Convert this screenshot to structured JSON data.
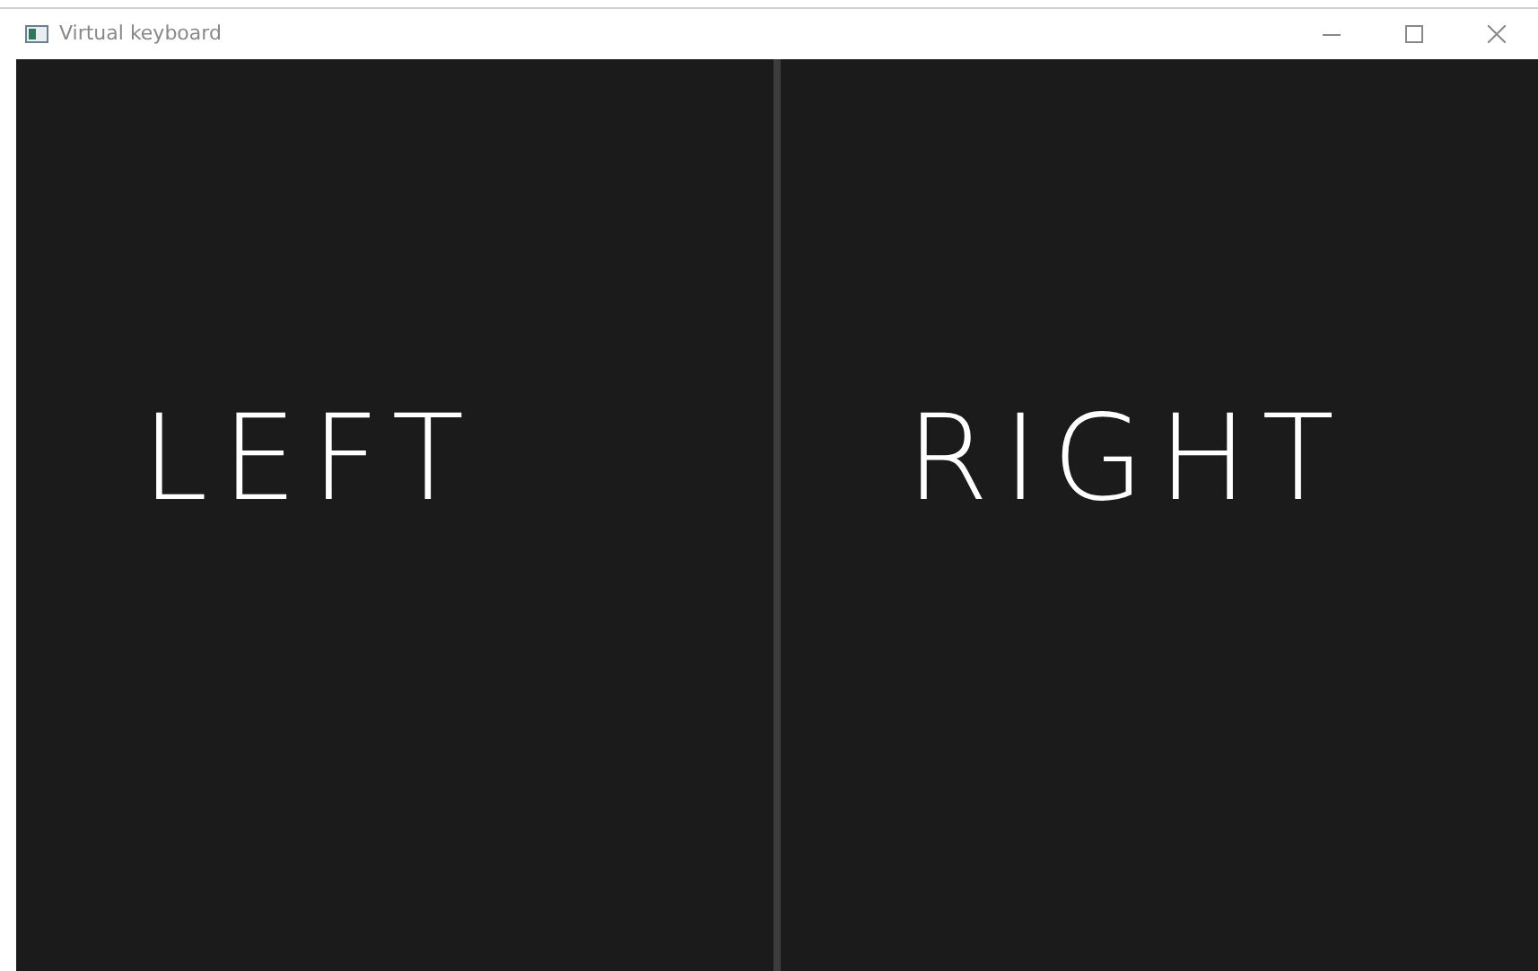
{
  "window": {
    "title": "Virtual keyboard"
  },
  "panels": [
    {
      "label": "LEFT"
    },
    {
      "label": "RIGHT"
    }
  ]
}
